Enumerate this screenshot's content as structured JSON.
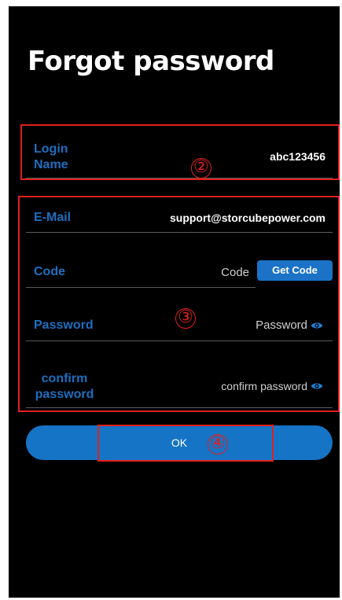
{
  "screen": {
    "title": "Forgot password"
  },
  "form": {
    "login_name": {
      "label": "Login Name",
      "label_line1": "Login",
      "label_line2": "Name",
      "value": "abc123456"
    },
    "email": {
      "label": "E-Mail",
      "value": "support@storcubepower.com"
    },
    "code": {
      "label": "Code",
      "placeholder": "Code",
      "button_label": "Get Code"
    },
    "password": {
      "label": "Password",
      "placeholder": "Password",
      "toggle_icon": "eye-icon"
    },
    "confirm_password": {
      "label_line1": "confirm",
      "label_line2": "password",
      "placeholder": "confirm password",
      "toggle_icon": "eye-icon"
    }
  },
  "actions": {
    "ok_label": "OK"
  },
  "annotations": {
    "marker_2": "②",
    "marker_3": "③",
    "marker_4": "④",
    "color": "#e0201e"
  },
  "colors": {
    "background": "#000000",
    "accent": "#1674c6",
    "label": "#1e6fc0"
  }
}
